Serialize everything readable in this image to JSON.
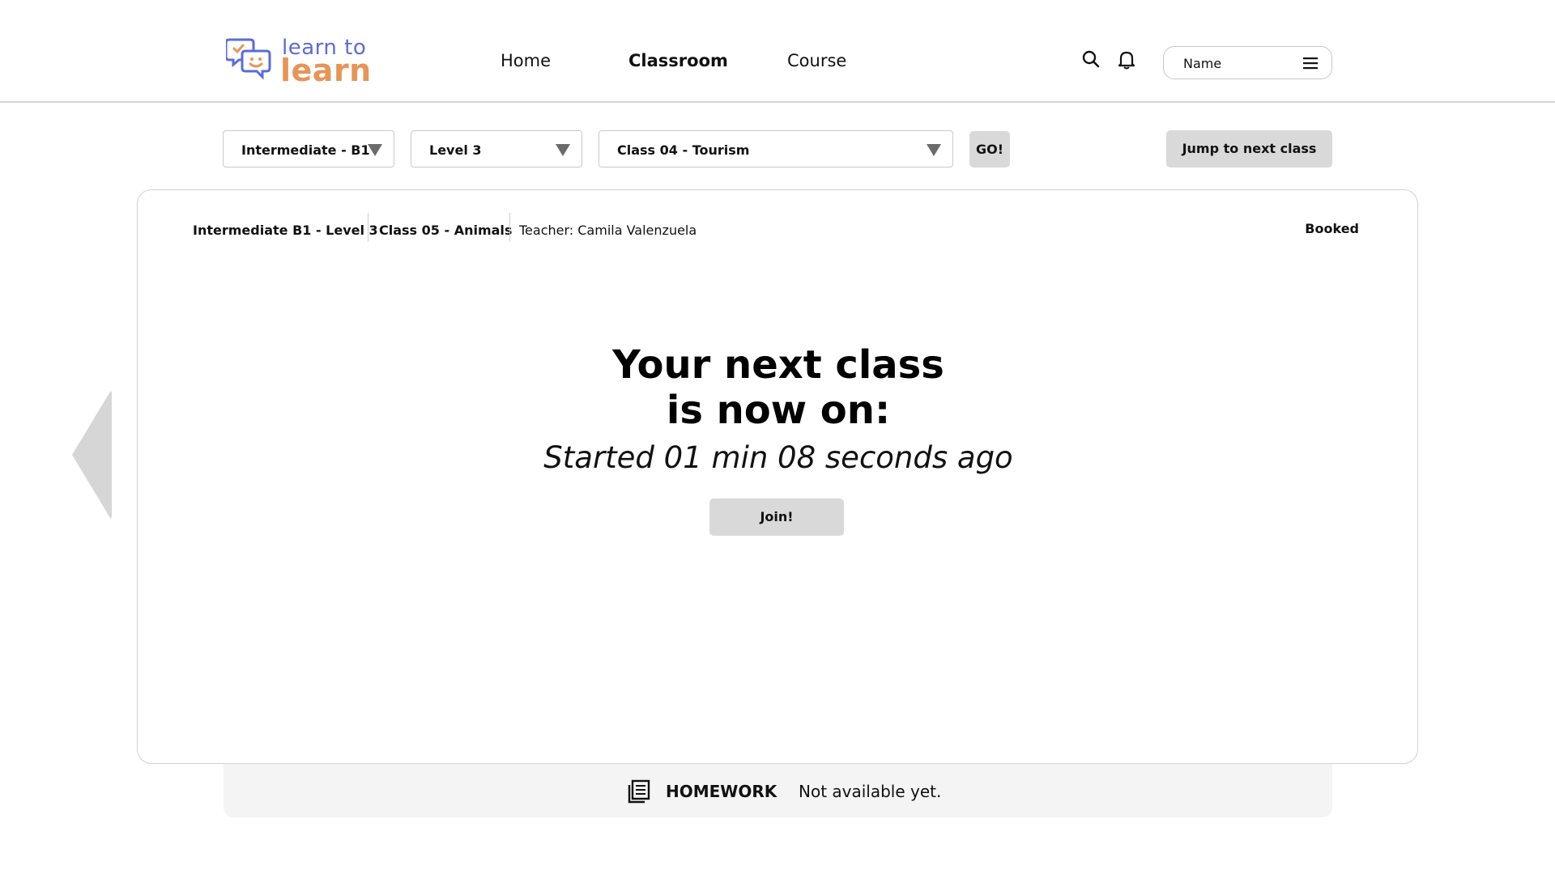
{
  "brand": {
    "line1": "learn to",
    "line2": "learn",
    "colors": {
      "primary": "#5b6cd9",
      "secondary": "#e69557"
    }
  },
  "nav": {
    "items": [
      {
        "label": "Home",
        "active": false
      },
      {
        "label": "Classroom",
        "active": true
      },
      {
        "label": "Course",
        "active": false
      }
    ]
  },
  "header": {
    "search_icon": "search-icon",
    "notification_icon": "bell-icon",
    "user": {
      "name": "Name",
      "menu_icon": "hamburger-menu-icon"
    }
  },
  "filters": {
    "course": "Intermediate - B1",
    "level": "Level 3",
    "class": "Class 04 - Tourism",
    "go_label": "GO!",
    "jump_label": "Jump to next class"
  },
  "class_card": {
    "course_level": "Intermediate B1 - Level 3",
    "class_name": "Class 05 - Animals",
    "teacher": "Teacher: Camila Valenzuela",
    "status": "Booked",
    "headline_line1": "Your next class",
    "headline_line2": "is now on:",
    "started": "Started 01 min 08 seconds ago",
    "join_label": "Join!"
  },
  "homework": {
    "icon": "homework-icon",
    "title": "HOMEWORK",
    "status": "Not available yet."
  },
  "colors": {
    "button_grey": "#d9d9d9",
    "arrow_grey": "#d6d6d6",
    "homework_bg": "#f4f4f4"
  }
}
